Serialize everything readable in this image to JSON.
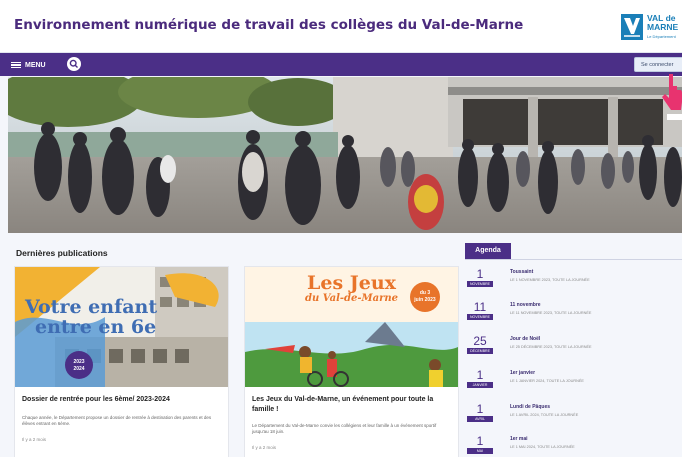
{
  "header": {
    "site_title": "Environnement numérique de travail des collèges du Val-de-Marne",
    "logo_line1": "VAL de",
    "logo_line2": "MARNE",
    "logo_sub": "Le Département"
  },
  "navbar": {
    "menu_label": "MENU",
    "login_label": "Se connecter"
  },
  "publications": {
    "section_title": "Dernières publications",
    "cards": [
      {
        "image_text_line1": "Votre enfant",
        "image_text_line2": "entre en 6e",
        "image_badge": "2023 2024",
        "title": "Dossier de rentrée pour les 6ème/ 2023-2024",
        "description": "Chaque année, le Département propose un dossier de rentrée à destination des parents et des élèves entrant en 6ème.",
        "date": "Il y a 2 mois"
      },
      {
        "image_text_line1": "Les Jeux",
        "image_text_line2": "du Val-de-Marne",
        "image_badge": "du 3 juin 2023",
        "title": "Les Jeux du Val-de-Marne, un événement pour toute la famille !",
        "description": "Le Département du Val-de-Marne convie les collégiens et leur famille à un événement sportif jusqu'au 18 juin.",
        "date": "Il y a 2 mois"
      }
    ]
  },
  "agenda": {
    "tab_label": "Agenda",
    "items": [
      {
        "day": "1",
        "month": "NOVEMBRE",
        "title": "Toussaint",
        "sub": "LE 1 NOVEMBRE 2023, TOUTE LA JOURNÉE"
      },
      {
        "day": "11",
        "month": "NOVEMBRE",
        "title": "11 novembre",
        "sub": "LE 11 NOVEMBRE 2023, TOUTE LA JOURNÉE"
      },
      {
        "day": "25",
        "month": "DÉCEMBRE",
        "title": "Jour de Noël",
        "sub": "LE 25 DÉCEMBRE 2023, TOUTE LA JOURNÉE"
      },
      {
        "day": "1",
        "month": "JANVIER",
        "title": "1er janvier",
        "sub": "LE 1 JANVIER 2024, TOUTE LA JOURNÉE"
      },
      {
        "day": "1",
        "month": "AVRIL",
        "title": "Lundi de Pâques",
        "sub": "LE 1 AVRIL 2024, TOUTE LA JOURNÉE"
      },
      {
        "day": "1",
        "month": "MAI",
        "title": "1er mai",
        "sub": "LE 1 MAI 2024, TOUTE LA JOURNÉE"
      }
    ]
  },
  "colors": {
    "brand_purple": "#4b2f87",
    "logo_blue": "#1a7fb8"
  },
  "icons": {
    "menu": "hamburger-icon",
    "search": "search-icon",
    "pointer": "hand-pointer-icon"
  }
}
